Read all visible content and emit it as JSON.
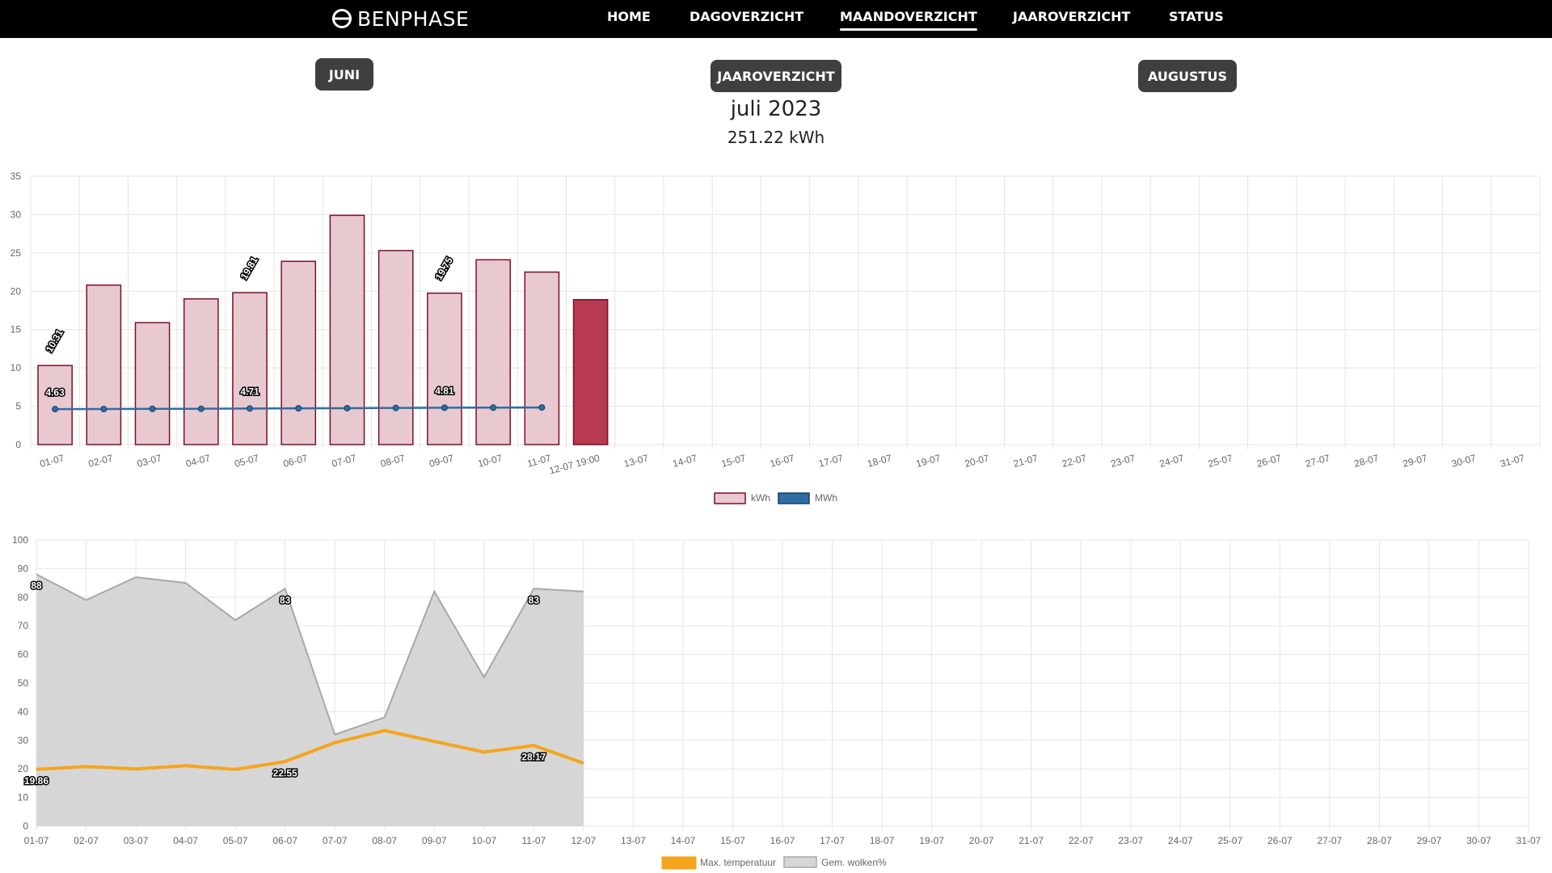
{
  "nav": {
    "brand": "BENPHASE",
    "items": [
      {
        "label": "HOME",
        "active": false
      },
      {
        "label": "DAGOVERZICHT",
        "active": false
      },
      {
        "label": "MAANDOVERZICHT",
        "active": true
      },
      {
        "label": "JAAROVERZICHT",
        "active": false
      },
      {
        "label": "STATUS",
        "active": false
      }
    ]
  },
  "controls": {
    "prev_label": "JUNI",
    "year_label": "JAAROVERZICHT",
    "next_label": "AUGUSTUS"
  },
  "summary": {
    "title": "juli 2023",
    "total": "251.22 kWh"
  },
  "colors": {
    "kwh_fill": "#e9c9d0",
    "kwh_border": "#7a0f26",
    "kwh_current_fill": "#b73a50",
    "mwh_line": "#2e6da4",
    "temp_line": "#f4a51c",
    "cloud_fill": "#d6d6d6",
    "cloud_line": "#a8a8a8"
  },
  "chart_data": [
    {
      "type": "bar",
      "categories": [
        "01-07",
        "02-07",
        "03-07",
        "04-07",
        "05-07",
        "06-07",
        "07-07",
        "08-07",
        "09-07",
        "10-07",
        "11-07",
        "12-07 19:00",
        "13-07",
        "14-07",
        "15-07",
        "16-07",
        "17-07",
        "18-07",
        "19-07",
        "20-07",
        "21-07",
        "22-07",
        "23-07",
        "24-07",
        "25-07",
        "26-07",
        "27-07",
        "28-07",
        "29-07",
        "30-07",
        "31-07"
      ],
      "ylim": [
        0,
        35
      ],
      "yticks": [
        0,
        5,
        10,
        15,
        20,
        25,
        30,
        35
      ],
      "grid": true,
      "legend": "bottom",
      "series": [
        {
          "name": "kWh",
          "type": "bar",
          "values": [
            10.31,
            20.8,
            15.9,
            19.0,
            19.81,
            23.9,
            29.9,
            25.3,
            19.75,
            24.1,
            22.5,
            18.9,
            null,
            null,
            null,
            null,
            null,
            null,
            null,
            null,
            null,
            null,
            null,
            null,
            null,
            null,
            null,
            null,
            null,
            null,
            null
          ],
          "labels": {
            "0": "10.31",
            "4": "19.81",
            "8": "19.75"
          }
        },
        {
          "name": "MWh",
          "type": "line",
          "values": [
            4.63,
            4.64,
            4.66,
            4.67,
            4.71,
            4.73,
            4.75,
            4.78,
            4.81,
            4.82,
            4.84,
            null,
            null,
            null,
            null,
            null,
            null,
            null,
            null,
            null,
            null,
            null,
            null,
            null,
            null,
            null,
            null,
            null,
            null,
            null,
            null
          ],
          "labels": {
            "0": "4.63",
            "4": "4.71",
            "8": "4.81"
          }
        }
      ]
    },
    {
      "type": "area",
      "categories": [
        "01-07",
        "02-07",
        "03-07",
        "04-07",
        "05-07",
        "06-07",
        "07-07",
        "08-07",
        "09-07",
        "10-07",
        "11-07",
        "12-07",
        "13-07",
        "14-07",
        "15-07",
        "16-07",
        "17-07",
        "18-07",
        "19-07",
        "20-07",
        "21-07",
        "22-07",
        "23-07",
        "24-07",
        "25-07",
        "26-07",
        "27-07",
        "28-07",
        "29-07",
        "30-07",
        "31-07"
      ],
      "ylim": [
        0,
        100
      ],
      "yticks": [
        0,
        10,
        20,
        30,
        40,
        50,
        60,
        70,
        80,
        90,
        100
      ],
      "grid": true,
      "legend": "bottom",
      "series": [
        {
          "name": "Max. temperatuur",
          "type": "line",
          "values": [
            19.86,
            20.8,
            20.0,
            21.1,
            19.8,
            22.55,
            29.2,
            33.4,
            29.6,
            25.9,
            28.17,
            22.0,
            null,
            null,
            null,
            null,
            null,
            null,
            null,
            null,
            null,
            null,
            null,
            null,
            null,
            null,
            null,
            null,
            null,
            null,
            null
          ],
          "labels": {
            "0": "19.86",
            "5": "22.55",
            "10": "28.17"
          }
        },
        {
          "name": "Gem. wolken%",
          "type": "area",
          "values": [
            88,
            79,
            87,
            85,
            72,
            83,
            32,
            38,
            82,
            52,
            83,
            82,
            null,
            null,
            null,
            null,
            null,
            null,
            null,
            null,
            null,
            null,
            null,
            null,
            null,
            null,
            null,
            null,
            null,
            null,
            null
          ],
          "labels": {
            "0": "88",
            "5": "83",
            "10": "83"
          }
        }
      ]
    }
  ]
}
